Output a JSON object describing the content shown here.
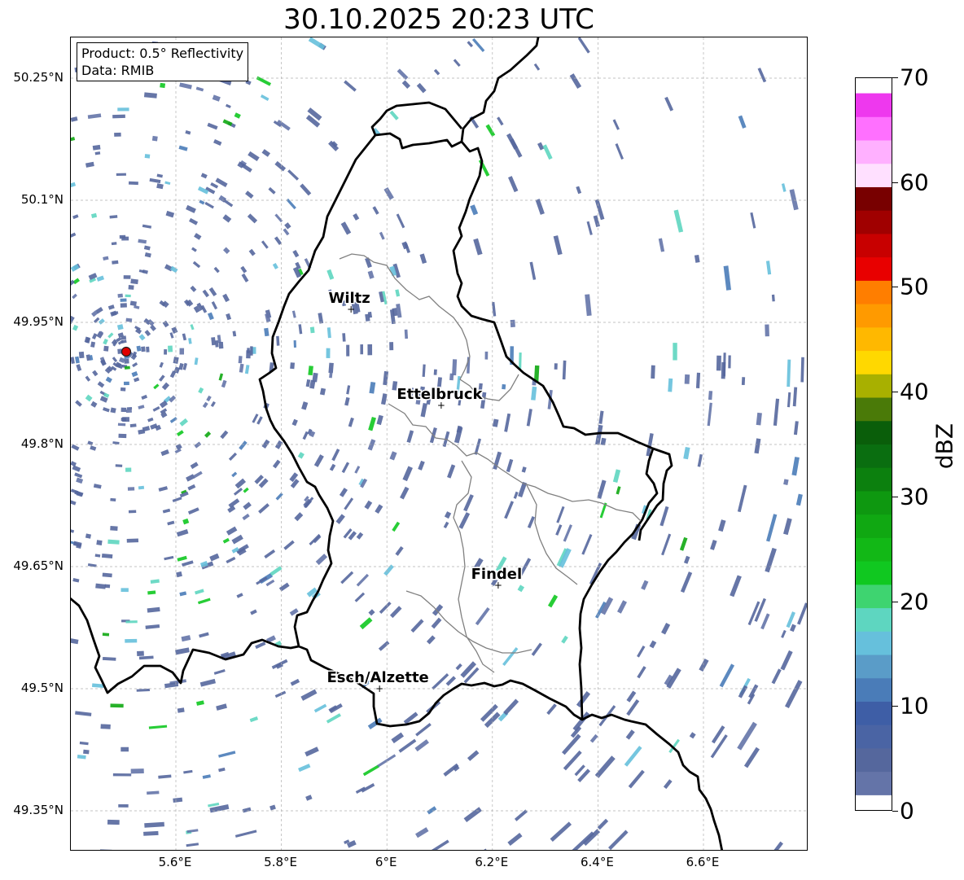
{
  "title": "30.10.2025 20:23 UTC",
  "info": {
    "product": "Product: 0.5° Reflectivity",
    "data_source": "Data: RMIB"
  },
  "map": {
    "lat_ticks": [
      "50.25°N",
      "50.1°N",
      "49.95°N",
      "49.8°N",
      "49.65°N",
      "49.5°N",
      "49.35°N"
    ],
    "lon_ticks": [
      "5.6°E",
      "5.8°E",
      "6°E",
      "6.2°E",
      "6.4°E",
      "6.6°E"
    ],
    "cities": [
      {
        "name": "Wiltz",
        "lat": 49.966,
        "lon": 5.932
      },
      {
        "name": "Ettelbruck",
        "lat": 49.848,
        "lon": 6.103
      },
      {
        "name": "Findel",
        "lat": 49.627,
        "lon": 6.211
      },
      {
        "name": "Esch/Alzette",
        "lat": 49.5,
        "lon": 5.986
      }
    ],
    "radar_site": {
      "lat": 49.915,
      "lon": 5.505
    },
    "colors": {
      "border": "#000000",
      "admin": "#808080",
      "grid": "#b0b0b0",
      "radar_marker": "#e00000"
    }
  },
  "colorbar": {
    "label": "dBZ",
    "tick_labels": [
      "0",
      "10",
      "20",
      "30",
      "40",
      "50",
      "60",
      "70"
    ],
    "min": 0,
    "max": 70,
    "step": 2.5,
    "colors": [
      "#6474a8",
      "#55679d",
      "#4a64a4",
      "#3e5ea6",
      "#4a7cb8",
      "#5a9cc8",
      "#66c0dc",
      "#5ed6c0",
      "#3ed470",
      "#10c820",
      "#12b816",
      "#10a812",
      "#0e9810",
      "#0c800e",
      "#0a6e10",
      "#0a5e0a",
      "#4a7a08",
      "#a8b000",
      "#ffd800",
      "#ffb800",
      "#ff9a00",
      "#ff7e00",
      "#e80000",
      "#c80000",
      "#a00000",
      "#780000",
      "#ffe0ff",
      "#ffb0ff",
      "#ff70ff",
      "#ee38ee"
    ]
  }
}
